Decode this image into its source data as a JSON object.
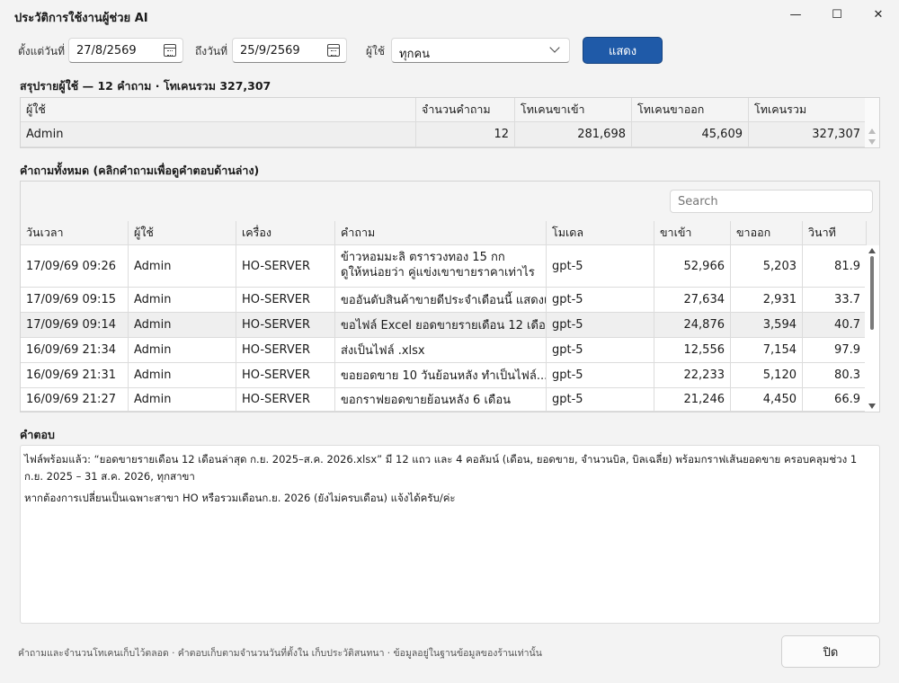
{
  "window": {
    "title": "ประวัติการใช้งานผู้ช่วย AI",
    "minimize": "—",
    "maximize": "☐",
    "close": "✕"
  },
  "filters": {
    "from_label": "ตั้งแต่วันที่",
    "from_value": "27/8/2569",
    "to_label": "ถึงวันที่",
    "to_value": "25/9/2569",
    "user_label": "ผู้ใช้",
    "user_value": "ทุกคน",
    "show_button": "แสดง"
  },
  "summary": {
    "title": "สรุปรายผู้ใช้ — 12 คำถาม · โทเคนรวม 327,307",
    "columns": [
      "ผู้ใช้",
      "จำนวนคำถาม",
      "โทเคนขาเข้า",
      "โทเคนขาออก",
      "โทเคนรวม"
    ],
    "rows": [
      {
        "user": "Admin",
        "questions": "12",
        "input_tokens": "281,698",
        "output_tokens": "45,609",
        "total_tokens": "327,307"
      }
    ]
  },
  "questions": {
    "title": "คำถามทั้งหมด (คลิกคำถามเพื่อดูคำตอบด้านล่าง)",
    "search_placeholder": "Search",
    "columns": [
      "วันเวลา",
      "ผู้ใช้",
      "เครื่อง",
      "คำถาม",
      "โมเดล",
      "ขาเข้า",
      "ขาออก",
      "วินาที"
    ],
    "rows": [
      {
        "datetime": "17/09/69 09:26",
        "user": "Admin",
        "machine": "HO-SERVER",
        "question": "ข้าวหอมมะลิ ตรารวงทอง 15 กก\nดูให้หน่อยว่า คู่แข่งเขาขายราคาเท่าไร",
        "model": "gpt-5",
        "input": "52,966",
        "output": "5,203",
        "seconds": "81.9"
      },
      {
        "datetime": "17/09/69 09:15",
        "user": "Admin",
        "machine": "HO-SERVER",
        "question": "ขออันดับสินค้าขายดีประจำเดือนนี้ แสดงเ...",
        "model": "gpt-5",
        "input": "27,634",
        "output": "2,931",
        "seconds": "33.7"
      },
      {
        "datetime": "17/09/69 09:14",
        "user": "Admin",
        "machine": "HO-SERVER",
        "question": "ขอไฟล์ Excel ยอดขายรายเดือน 12 เดือ...",
        "model": "gpt-5",
        "input": "24,876",
        "output": "3,594",
        "seconds": "40.7"
      },
      {
        "datetime": "16/09/69 21:34",
        "user": "Admin",
        "machine": "HO-SERVER",
        "question": "ส่งเป็นไฟล์ .xlsx",
        "model": "gpt-5",
        "input": "12,556",
        "output": "7,154",
        "seconds": "97.9"
      },
      {
        "datetime": "16/09/69 21:31",
        "user": "Admin",
        "machine": "HO-SERVER",
        "question": "ขอยอดขาย 10 วันย้อนหลัง ทำเป็นไฟล์...",
        "model": "gpt-5",
        "input": "22,233",
        "output": "5,120",
        "seconds": "80.3"
      },
      {
        "datetime": "16/09/69 21:27",
        "user": "Admin",
        "machine": "HO-SERVER",
        "question": "ขอกราฟยอดขายย้อนหลัง 6 เดือน",
        "model": "gpt-5",
        "input": "21,246",
        "output": "4,450",
        "seconds": "66.9"
      }
    ]
  },
  "answer": {
    "title": "คำตอบ",
    "paragraph1": "ไฟล์พร้อมแล้ว: “ยอดขายรายเดือน 12 เดือนล่าสุด ก.ย. 2025–ส.ค. 2026.xlsx” มี 12 แถว และ 4 คอลัมน์ (เดือน, ยอดขาย, จำนวนบิล, บิลเฉลี่ย) พร้อมกราฟเส้นยอดขาย ครอบคลุมช่วง 1 ก.ย. 2025 – 31 ส.ค. 2026, ทุกสาขา",
    "paragraph2": "หากต้องการเปลี่ยนเป็นเฉพาะสาขา HO หรือรวมเดือนก.ย. 2026 (ยังไม่ครบเดือน) แจ้งได้ครับ/ค่ะ"
  },
  "footer": {
    "note": "คำถามและจำนวนโทเคนเก็บไว้ตลอด · คำตอบเก็บตามจำนวนวันที่ตั้งใน เก็บประวัติสนทนา · ข้อมูลอยู่ในฐานข้อมูลของร้านเท่านั้น",
    "close_button": "ปิด"
  }
}
